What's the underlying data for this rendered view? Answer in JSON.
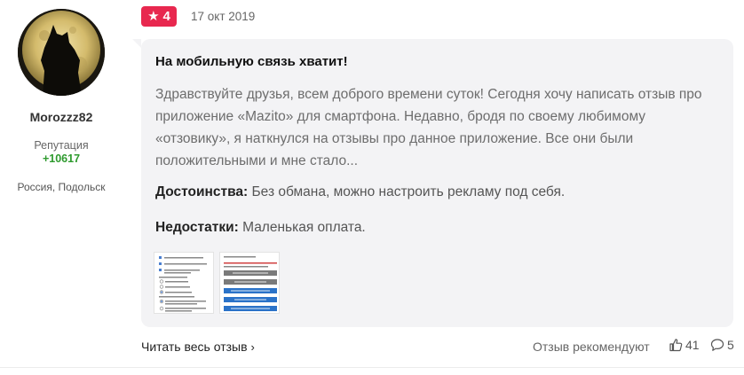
{
  "author": {
    "name": "Morozzz82",
    "reputation_label": "Репутация",
    "reputation_value": "+10617",
    "location": "Россия, Подольск"
  },
  "review": {
    "rating": "4",
    "date": "17 окт 2019",
    "title": "На мобильную связь хватит!",
    "text": "Здравствуйте друзья, всем доброго времени суток! Сегодня хочу написать отзыв про приложение «Mazito» для смартфона. Недавно, бродя по своему любимому «отзовику», я наткнулся на отзывы про данное приложение. Все они были положительными и мне стало...",
    "pros_label": "Достоинства:",
    "pros_text": " Без обмана, можно настроить рекламу под себя.",
    "cons_label": "Недостатки:",
    "cons_text": " Маленькая оплата."
  },
  "footer": {
    "read_more": "Читать весь отзыв",
    "recommend_label": "Отзыв рекомендуют",
    "likes": "41",
    "comments": "5"
  },
  "colors": {
    "badge": "#e8284f",
    "reputation": "#2e9a2e",
    "box_bg": "#f3f3f5"
  },
  "icons": {
    "rating": "star-icon",
    "read_more": "chevron-right-icon",
    "likes": "thumbs-up-icon",
    "comments": "speech-bubble-icon"
  }
}
